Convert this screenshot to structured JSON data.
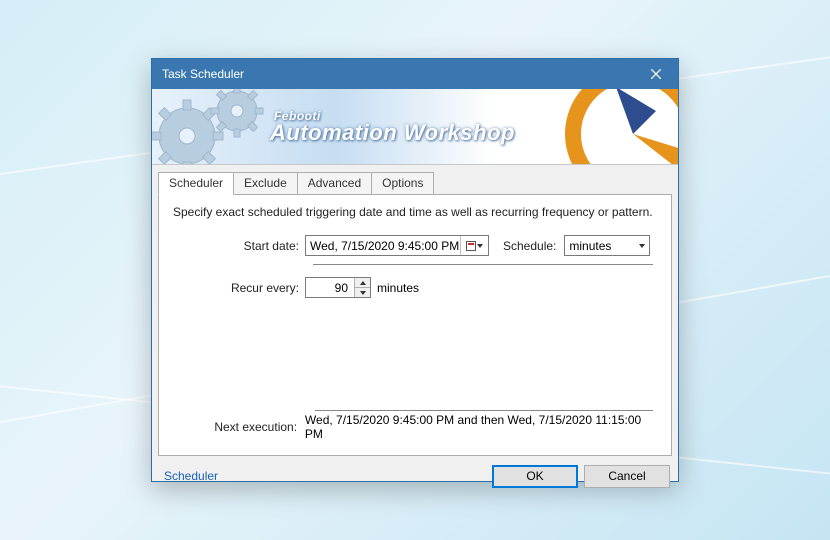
{
  "window": {
    "title": "Task Scheduler"
  },
  "banner": {
    "sub": "Febooti",
    "main": "Automation Workshop"
  },
  "tabs": [
    {
      "label": "Scheduler",
      "active": true
    },
    {
      "label": "Exclude",
      "active": false
    },
    {
      "label": "Advanced",
      "active": false
    },
    {
      "label": "Options",
      "active": false
    }
  ],
  "scheduler": {
    "description": "Specify exact scheduled triggering date and time as well as recurring frequency or pattern.",
    "start_date_label": "Start date:",
    "start_date_value": "Wed,   7/15/2020   9:45:00 PM",
    "schedule_label": "Schedule:",
    "schedule_value": "minutes",
    "recur_label": "Recur every:",
    "recur_value": "90",
    "recur_unit": "minutes",
    "next_label": "Next execution:",
    "next_value": "Wed, 7/15/2020 9:45:00 PM and then Wed, 7/15/2020 11:15:00 PM"
  },
  "footer": {
    "link": "Scheduler",
    "ok": "OK",
    "cancel": "Cancel"
  }
}
